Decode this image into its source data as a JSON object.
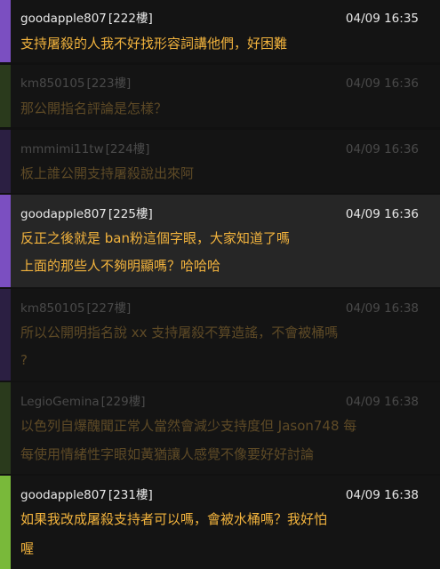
{
  "colors": {
    "purple_bar": "#7b4fc1",
    "dark_green_bar": "#2a3a1c",
    "dark_purple_bar": "#2b1f42",
    "green_bar": "#79b93a",
    "highlight_text": "#f2b33d",
    "dim_text": "#5e4a26"
  },
  "comments": [
    {
      "user": "goodapple807",
      "floor": "[222樓]",
      "time": "04/09 16:35",
      "lines": [
        "支持屠殺的人我不好找形容詞講他們，好困難"
      ]
    },
    {
      "user": "km850105",
      "floor": "[223樓]",
      "time": "04/09 16:36",
      "lines": [
        "那公開指名評論是怎樣？"
      ]
    },
    {
      "user": "mmmimi11tw",
      "floor": "[224樓]",
      "time": "04/09 16:36",
      "lines": [
        "板上誰公開支持屠殺說出來阿"
      ]
    },
    {
      "user": "goodapple807",
      "floor": "[225樓]",
      "time": "04/09 16:36",
      "lines": [
        "反正之後就是 ban粉這個字眼，大家知道了嗎",
        "上面的那些人不夠明顯嗎？哈哈哈"
      ]
    },
    {
      "user": "km850105",
      "floor": "[227樓]",
      "time": "04/09 16:38",
      "lines": [
        "所以公開明指名說 xx 支持屠殺不算造謠，不會被桶嗎",
        "?"
      ]
    },
    {
      "user": "LegioGemina",
      "floor": "[229樓]",
      "time": "04/09 16:38",
      "lines": [
        "以色列自爆醜聞正常人當然會減少支持度但 Jason748 每",
        "每使用情緒性字眼如黃猶讓人感覺不像要好好討論"
      ]
    },
    {
      "user": "goodapple807",
      "floor": "[231樓]",
      "time": "04/09 16:38",
      "lines": [
        "如果我改成屠殺支持者可以嗎，會被水桶嗎？我好怕",
        "喔"
      ]
    }
  ]
}
